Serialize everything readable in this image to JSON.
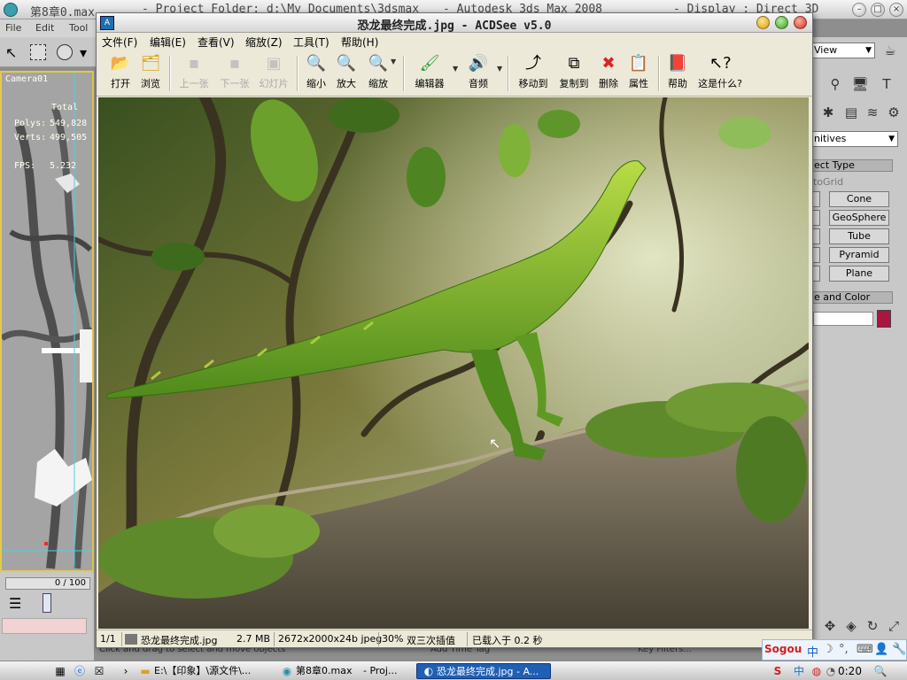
{
  "max_window": {
    "title_left": "第8章0.max",
    "title_project": "- Project Folder: d:\\My Documents\\3dsmax",
    "title_app": "- Autodesk 3ds Max 2008",
    "title_display": "- Display : Direct 3D",
    "menu": [
      "File",
      "Edit",
      "Tool"
    ],
    "viewport": {
      "label": "Camera01",
      "total_label": "Total",
      "polys_label": "Polys:",
      "polys_value": "549,828",
      "verts_label": "Verts:",
      "verts_value": "499,505",
      "fps_label": "FPS:",
      "fps_value": "5.232"
    },
    "frame_counter": "0 / 100",
    "status_text": "Click and drag to select and move objects",
    "add_time_tag": "Add Time Tag",
    "key_filters": "Key Filters..."
  },
  "right_panel": {
    "view_dropdown": "View",
    "primitives_dropdown": "nitives",
    "object_type_header": "ect Type",
    "autogrid": "toGrid",
    "buttons": [
      "Cone",
      "GeoSphere",
      "Tube",
      "Pyramid",
      "Plane"
    ],
    "name_color_header": "e and Color",
    "color": "#a8173f"
  },
  "acdsee": {
    "title": "恐龙最终完成.jpg - ACDSee v5.0",
    "menu": [
      "文件(F)",
      "编辑(E)",
      "查看(V)",
      "缩放(Z)",
      "工具(T)",
      "帮助(H)"
    ],
    "toolbar": [
      {
        "label": "打开",
        "icon": "open-folder-icon",
        "glyph": "📂",
        "enabled": true
      },
      {
        "label": "浏览",
        "icon": "browse-icon",
        "glyph": "🗂",
        "enabled": true
      },
      {
        "label": "上一张",
        "icon": "previous-image-icon",
        "glyph": "◀",
        "enabled": false
      },
      {
        "label": "下一张",
        "icon": "next-image-icon",
        "glyph": "▶",
        "enabled": false
      },
      {
        "label": "幻灯片",
        "icon": "slideshow-icon",
        "glyph": "▣",
        "enabled": false
      },
      {
        "label": "缩小",
        "icon": "zoom-out-icon",
        "glyph": "🔍",
        "enabled": true
      },
      {
        "label": "放大",
        "icon": "zoom-in-icon",
        "glyph": "🔍",
        "enabled": true
      },
      {
        "label": "缩放",
        "icon": "zoom-icon",
        "glyph": "🔍",
        "enabled": true
      },
      {
        "label": "编辑器",
        "icon": "editor-icon",
        "glyph": "🖌",
        "enabled": true
      },
      {
        "label": "音频",
        "icon": "audio-icon",
        "glyph": "🔊",
        "enabled": true
      },
      {
        "label": "移动到",
        "icon": "move-to-icon",
        "glyph": "⤴",
        "enabled": true
      },
      {
        "label": "复制到",
        "icon": "copy-to-icon",
        "glyph": "⧉",
        "enabled": true
      },
      {
        "label": "删除",
        "icon": "delete-icon",
        "glyph": "✖",
        "enabled": true
      },
      {
        "label": "属性",
        "icon": "properties-icon",
        "glyph": "📋",
        "enabled": true
      },
      {
        "label": "帮助",
        "icon": "help-book-icon",
        "glyph": "📕",
        "enabled": true
      },
      {
        "label": "这是什么?",
        "icon": "whats-this-icon",
        "glyph": "❓",
        "enabled": true
      }
    ],
    "status": {
      "index": "1/1",
      "filename": "恐龙最终完成.jpg",
      "size": "2.7 MB",
      "dimensions": "2672x2000x24b jpeg",
      "zoom": "30%",
      "interp": "双三次插值",
      "loaded": "已载入于 0.2 秒"
    }
  },
  "taskbar": {
    "items": [
      {
        "label": "E:\\【印象】\\源文件\\...",
        "icon": "folder-icon"
      },
      {
        "label": "第8章0.max",
        "icon": "3dsmax-icon"
      },
      {
        "label": "- Proj...",
        "icon": "window-icon"
      },
      {
        "label": "恐龙最终完成.jpg - A...",
        "icon": "acdsee-icon"
      }
    ],
    "tray": {
      "ime": "Sogou",
      "ime_mode": "中",
      "clock": "0:20"
    }
  }
}
